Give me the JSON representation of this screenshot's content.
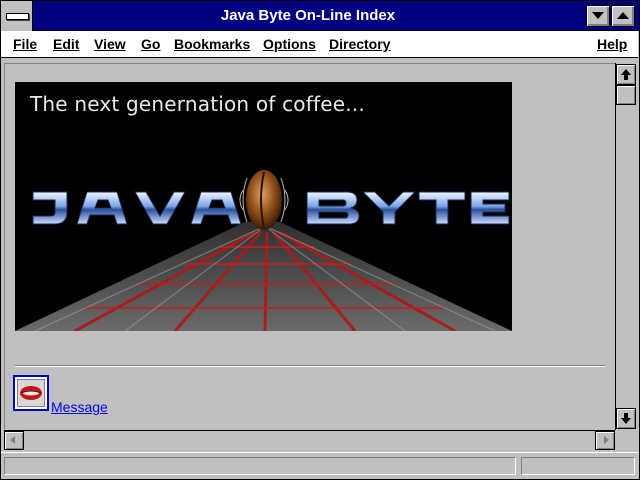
{
  "window": {
    "title": "Java Byte On-Line Index",
    "controls": [
      "system-menu",
      "minimize",
      "maximize"
    ]
  },
  "menu": {
    "items": [
      {
        "label": "File",
        "mnemonic": "F"
      },
      {
        "label": "Edit",
        "mnemonic": "E"
      },
      {
        "label": "View",
        "mnemonic": "V"
      },
      {
        "label": "Go",
        "mnemonic": "G"
      },
      {
        "label": "Bookmarks",
        "mnemonic": "B"
      },
      {
        "label": "Options",
        "mnemonic": "O"
      },
      {
        "label": "Directory",
        "mnemonic": "D"
      },
      {
        "label": "Help",
        "mnemonic": "H"
      }
    ]
  },
  "page": {
    "banner": {
      "tagline": "The next genernation of coffee...",
      "logo_text": "JAVA BYTE"
    },
    "message_link": "Message",
    "message_icon": "lips-icon"
  },
  "scrollbars": {
    "vertical": {
      "position": 0
    },
    "horizontal": {
      "position": 0
    }
  },
  "status": {
    "text": ""
  },
  "colors": {
    "titlebar": "#000080",
    "window_face": "#c0c0c0",
    "link": "#0000ee"
  }
}
